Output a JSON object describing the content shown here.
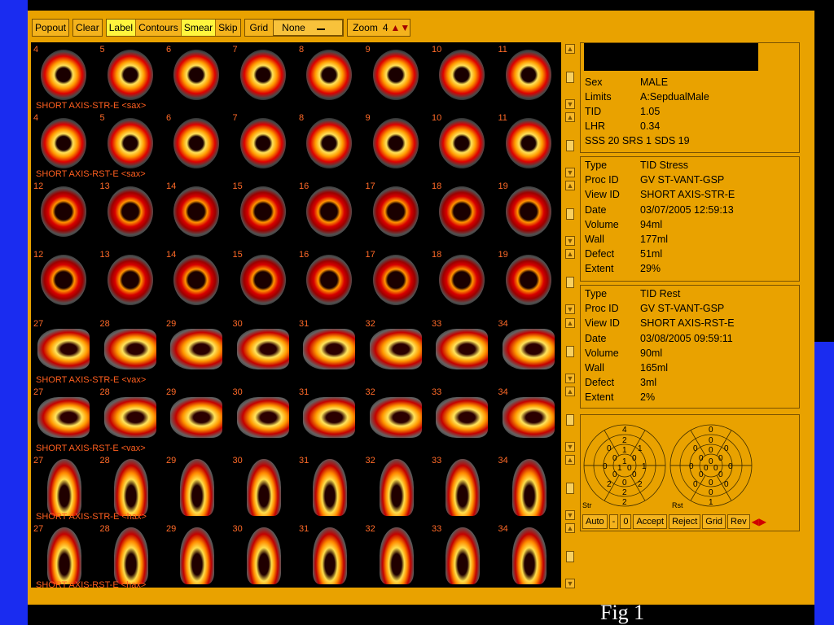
{
  "toolbar": {
    "popout": "Popout",
    "clear": "Clear",
    "label": "Label",
    "contours": "Contours",
    "smear": "Smear",
    "skip": "Skip",
    "grid_label": "Grid",
    "grid_value": "None",
    "zoom_label": "Zoom",
    "zoom_value": "4"
  },
  "rows": [
    {
      "type": "sax",
      "numbers": [
        "4",
        "5",
        "6",
        "7",
        "8",
        "9",
        "10",
        "11"
      ],
      "label": "SHORT AXIS-STR-E  <sax>"
    },
    {
      "type": "sax",
      "numbers": [
        "4",
        "5",
        "6",
        "7",
        "8",
        "9",
        "10",
        "11"
      ],
      "label": "SHORT AXIS-RST-E  <sax>"
    },
    {
      "type": "sax2",
      "numbers": [
        "12",
        "13",
        "14",
        "15",
        "16",
        "17",
        "18",
        "19"
      ],
      "label": ""
    },
    {
      "type": "sax2",
      "numbers": [
        "12",
        "13",
        "14",
        "15",
        "16",
        "17",
        "18",
        "19"
      ],
      "label": ""
    },
    {
      "type": "vax",
      "numbers": [
        "27",
        "28",
        "29",
        "30",
        "31",
        "32",
        "33",
        "34"
      ],
      "label": "SHORT AXIS-STR-E  <vax>"
    },
    {
      "type": "vax",
      "numbers": [
        "27",
        "28",
        "29",
        "30",
        "31",
        "32",
        "33",
        "34"
      ],
      "label": "SHORT AXIS-RST-E  <vax>"
    },
    {
      "type": "hax",
      "numbers": [
        "27",
        "28",
        "29",
        "30",
        "31",
        "32",
        "33",
        "34"
      ],
      "label": "SHORT AXIS-STR-E  <hax>"
    },
    {
      "type": "hax",
      "numbers": [
        "27",
        "28",
        "29",
        "30",
        "31",
        "32",
        "33",
        "34"
      ],
      "label": "SHORT AXIS-RST-E  <hax>"
    }
  ],
  "patient": {
    "rows": [
      {
        "k": "Sex",
        "v": "MALE"
      },
      {
        "k": "Limits",
        "v": "A:SepdualMale"
      },
      {
        "k": "TID",
        "v": "1.05"
      },
      {
        "k": "LHR",
        "v": "0.34"
      }
    ],
    "scores": "SSS  20   SRS  1    SDS  19"
  },
  "stress": [
    {
      "k": "Type",
      "v": "TID Stress"
    },
    {
      "k": "Proc ID",
      "v": "GV ST-VANT-GSP"
    },
    {
      "k": "View ID",
      "v": "SHORT AXIS-STR-E"
    },
    {
      "k": "Date",
      "v": "03/07/2005 12:59:13"
    },
    {
      "k": "Volume",
      "v": "94ml"
    },
    {
      "k": "Wall",
      "v": "177ml"
    },
    {
      "k": "Defect",
      "v": "51ml"
    },
    {
      "k": "Extent",
      "v": "29%"
    }
  ],
  "rest": [
    {
      "k": "Type",
      "v": "TID Rest"
    },
    {
      "k": "Proc ID",
      "v": "GV ST-VANT-GSP"
    },
    {
      "k": "View ID",
      "v": "SHORT AXIS-RST-E"
    },
    {
      "k": "Date",
      "v": "03/08/2005 09:59:11"
    },
    {
      "k": "Volume",
      "v": "90ml"
    },
    {
      "k": "Wall",
      "v": "165ml"
    },
    {
      "k": "Defect",
      "v": "3ml"
    },
    {
      "k": "Extent",
      "v": "2%"
    }
  ],
  "polar": {
    "str_label": "Str",
    "rst_label": "Rst",
    "str_outer_top": "4",
    "str_outer_bottom": "2",
    "str_values": [
      "2",
      "1",
      "1",
      "2",
      "2",
      "2",
      "0",
      "0",
      "1",
      "0",
      "0",
      "0",
      "0",
      "0",
      "1",
      "0",
      "1"
    ],
    "rst_outer_top": "0",
    "rst_outer_bottom": "1",
    "rst_values": [
      "0",
      "0",
      "0",
      "0",
      "0",
      "0",
      "0",
      "0",
      "0",
      "0",
      "0",
      "0",
      "0",
      "0",
      "0",
      "0",
      "0"
    ]
  },
  "polar_controls": {
    "auto": "Auto",
    "minus": "-",
    "zero": "0",
    "accept": "Accept",
    "reject": "Reject",
    "grid": "Grid",
    "rev": "Rev"
  },
  "caption": "Fig 1"
}
